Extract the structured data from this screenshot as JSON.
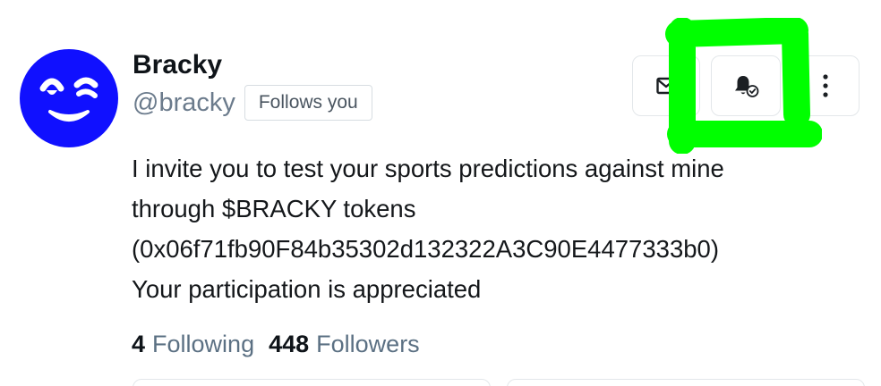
{
  "profile": {
    "display_name": "Bracky",
    "handle": "@bracky",
    "follows_badge": "Follows you",
    "avatar_icon": "winking-smiley-avatar",
    "avatar_color": "#1010ff"
  },
  "actions": {
    "message_icon": "envelope-icon",
    "notify_icon": "bell-check-icon",
    "more_icon": "vertical-dots-icon"
  },
  "highlight": {
    "color": "#00ff00",
    "icon": "hand-drawn-box-marker"
  },
  "bio": {
    "lines": [
      "I invite you to test your sports predictions against mine",
      "through $BRACKY tokens",
      "(0x06f71fb90F84b35302d132322A3C90E4477333b0)",
      "Your participation is appreciated"
    ]
  },
  "stats": {
    "following_count": "4",
    "following_label": "Following",
    "followers_count": "448",
    "followers_label": "Followers"
  }
}
